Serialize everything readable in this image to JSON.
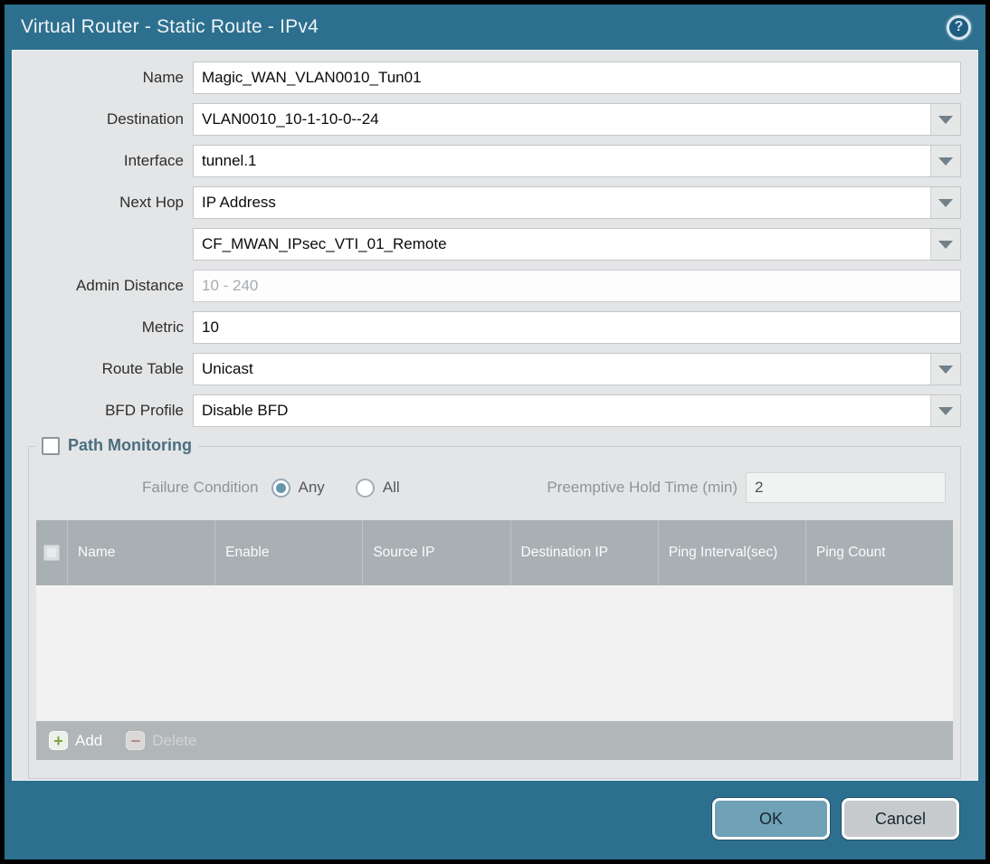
{
  "window": {
    "title": "Virtual Router - Static Route - IPv4",
    "help_glyph": "?"
  },
  "form": {
    "name": {
      "label": "Name",
      "value": "Magic_WAN_VLAN0010_Tun01"
    },
    "destination": {
      "label": "Destination",
      "value": "VLAN0010_10-1-10-0--24"
    },
    "interface": {
      "label": "Interface",
      "value": "tunnel.1"
    },
    "next_hop": {
      "label": "Next Hop",
      "value": "IP Address"
    },
    "next_hop_address": {
      "label": "",
      "value": "CF_MWAN_IPsec_VTI_01_Remote"
    },
    "admin_distance": {
      "label": "Admin Distance",
      "value": "",
      "placeholder": "10 - 240"
    },
    "metric": {
      "label": "Metric",
      "value": "10"
    },
    "route_table": {
      "label": "Route Table",
      "value": "Unicast"
    },
    "bfd_profile": {
      "label": "BFD Profile",
      "value": "Disable BFD"
    }
  },
  "path_monitoring": {
    "legend": "Path Monitoring",
    "enabled": false,
    "failure_condition_label": "Failure Condition",
    "any_label": "Any",
    "all_label": "All",
    "failure_condition_selected": "Any",
    "preemptive_label": "Preemptive Hold Time (min)",
    "preemptive_value": "2",
    "table": {
      "columns": [
        "Name",
        "Enable",
        "Source IP",
        "Destination IP",
        "Ping Interval(sec)",
        "Ping Count"
      ],
      "rows": []
    },
    "add_label": "Add",
    "delete_label": "Delete"
  },
  "footer": {
    "ok_label": "OK",
    "cancel_label": "Cancel"
  },
  "colors": {
    "frame_teal": "#2d6f8e",
    "panel_gray": "#e4e5e6",
    "table_header_gray": "#a9b0b4",
    "ok_button": "#6fa1b7",
    "legend_text": "#4a6e80",
    "add_plus_green": "#7ba23f",
    "delete_minus_red": "#b07a70"
  }
}
